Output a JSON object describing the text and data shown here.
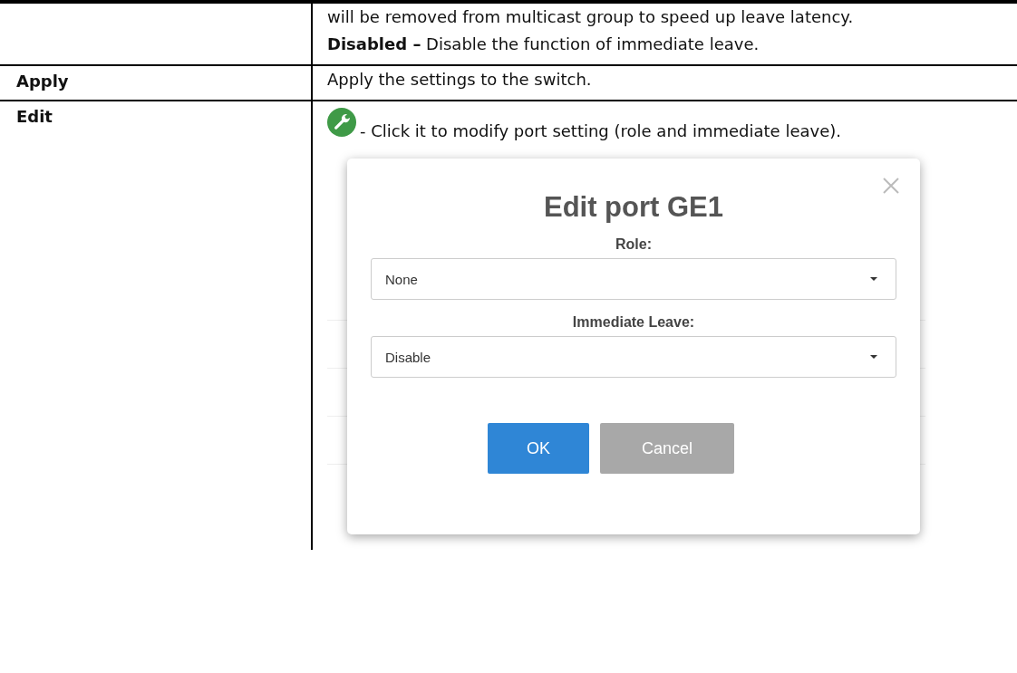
{
  "rows": [
    {
      "kind": "text",
      "paragraphs": [
        "will be removed from multicast group to speed up leave latency.",
        "**Disabled –** Disable the function of immediate leave."
      ]
    },
    {
      "kind": "text",
      "term": "Apply",
      "paragraphs": [
        "Apply the settings to the switch."
      ]
    },
    {
      "kind": "dialog",
      "term": "Edit",
      "paragraphs": [
        "- Click it to modify port setting (role and immediate leave)."
      ],
      "dialog": {
        "title": "Edit port GE1",
        "fields": [
          {
            "label": "Role:",
            "value": "None"
          },
          {
            "label": "Immediate Leave:",
            "value": "Disable"
          }
        ],
        "buttons": [
          {
            "label": "OK",
            "kind": "primary"
          },
          {
            "label": "Cancel",
            "kind": "secondary"
          }
        ]
      }
    }
  ]
}
